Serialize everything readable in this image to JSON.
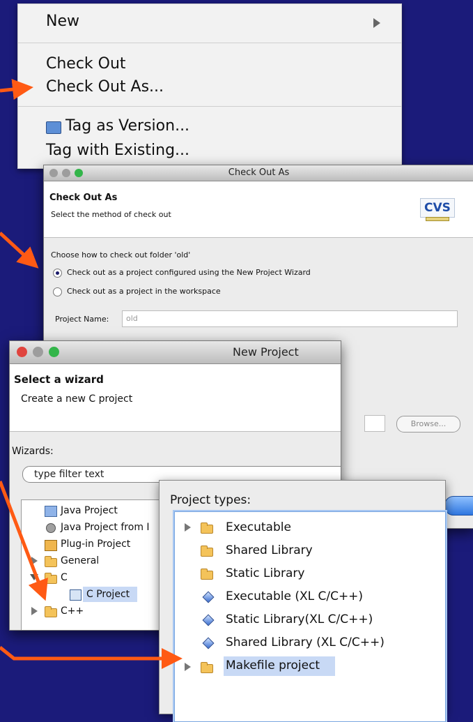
{
  "context_menu": {
    "items": [
      {
        "label": "New",
        "has_submenu": true
      },
      {
        "label": "Check Out"
      },
      {
        "label": "Check Out As..."
      },
      {
        "label": "Tag as Version...",
        "icon": "tag-icon"
      },
      {
        "label": "Tag with Existing..."
      }
    ]
  },
  "checkout_dialog": {
    "window_title": "Check Out As",
    "header_title": "Check Out As",
    "header_subtitle": "Select the method of check out",
    "logo_text": "CVS",
    "prompt": "Choose how to check out folder 'old'",
    "options": [
      {
        "label": "Check out as a project configured using the New Project Wizard",
        "selected": true
      },
      {
        "label": "Check out as a project in the workspace",
        "selected": false
      }
    ],
    "project_name_label": "Project Name:",
    "project_name_value": "old",
    "browse_label": "Browse..."
  },
  "new_project_dialog": {
    "window_title": "New Project",
    "header_title": "Select a wizard",
    "header_subtitle": "Create a new C project",
    "wizards_label": "Wizards:",
    "filter_placeholder": "type filter text",
    "tree": [
      {
        "label": "Java Project",
        "icon": "java-project-icon"
      },
      {
        "label": "Java Project from I",
        "icon": "java-project-from-existing-icon"
      },
      {
        "label": "Plug-in Project",
        "icon": "plugin-project-icon"
      },
      {
        "label": "General",
        "icon": "folder-icon"
      },
      {
        "label": "C",
        "icon": "folder-icon",
        "expanded": true
      },
      {
        "label": "C Project",
        "icon": "c-project-icon",
        "selected": true
      },
      {
        "label": "C++",
        "icon": "folder-icon"
      }
    ]
  },
  "project_types": {
    "label": "Project types:",
    "items": [
      {
        "label": "Executable",
        "kind": "folder",
        "expandable": true
      },
      {
        "label": "Shared Library",
        "kind": "folder"
      },
      {
        "label": "Static Library",
        "kind": "folder"
      },
      {
        "label": "Executable (XL C/C++)",
        "kind": "diamond"
      },
      {
        "label": "Static Library(XL C/C++)",
        "kind": "diamond"
      },
      {
        "label": "Shared Library (XL C/C++)",
        "kind": "diamond"
      },
      {
        "label": "Makefile project",
        "kind": "folder",
        "expandable": true,
        "selected": true
      }
    ]
  },
  "colors": {
    "background": "#1b1b7a",
    "arrow": "#ff5a14",
    "selection": "#c8d9f5"
  }
}
